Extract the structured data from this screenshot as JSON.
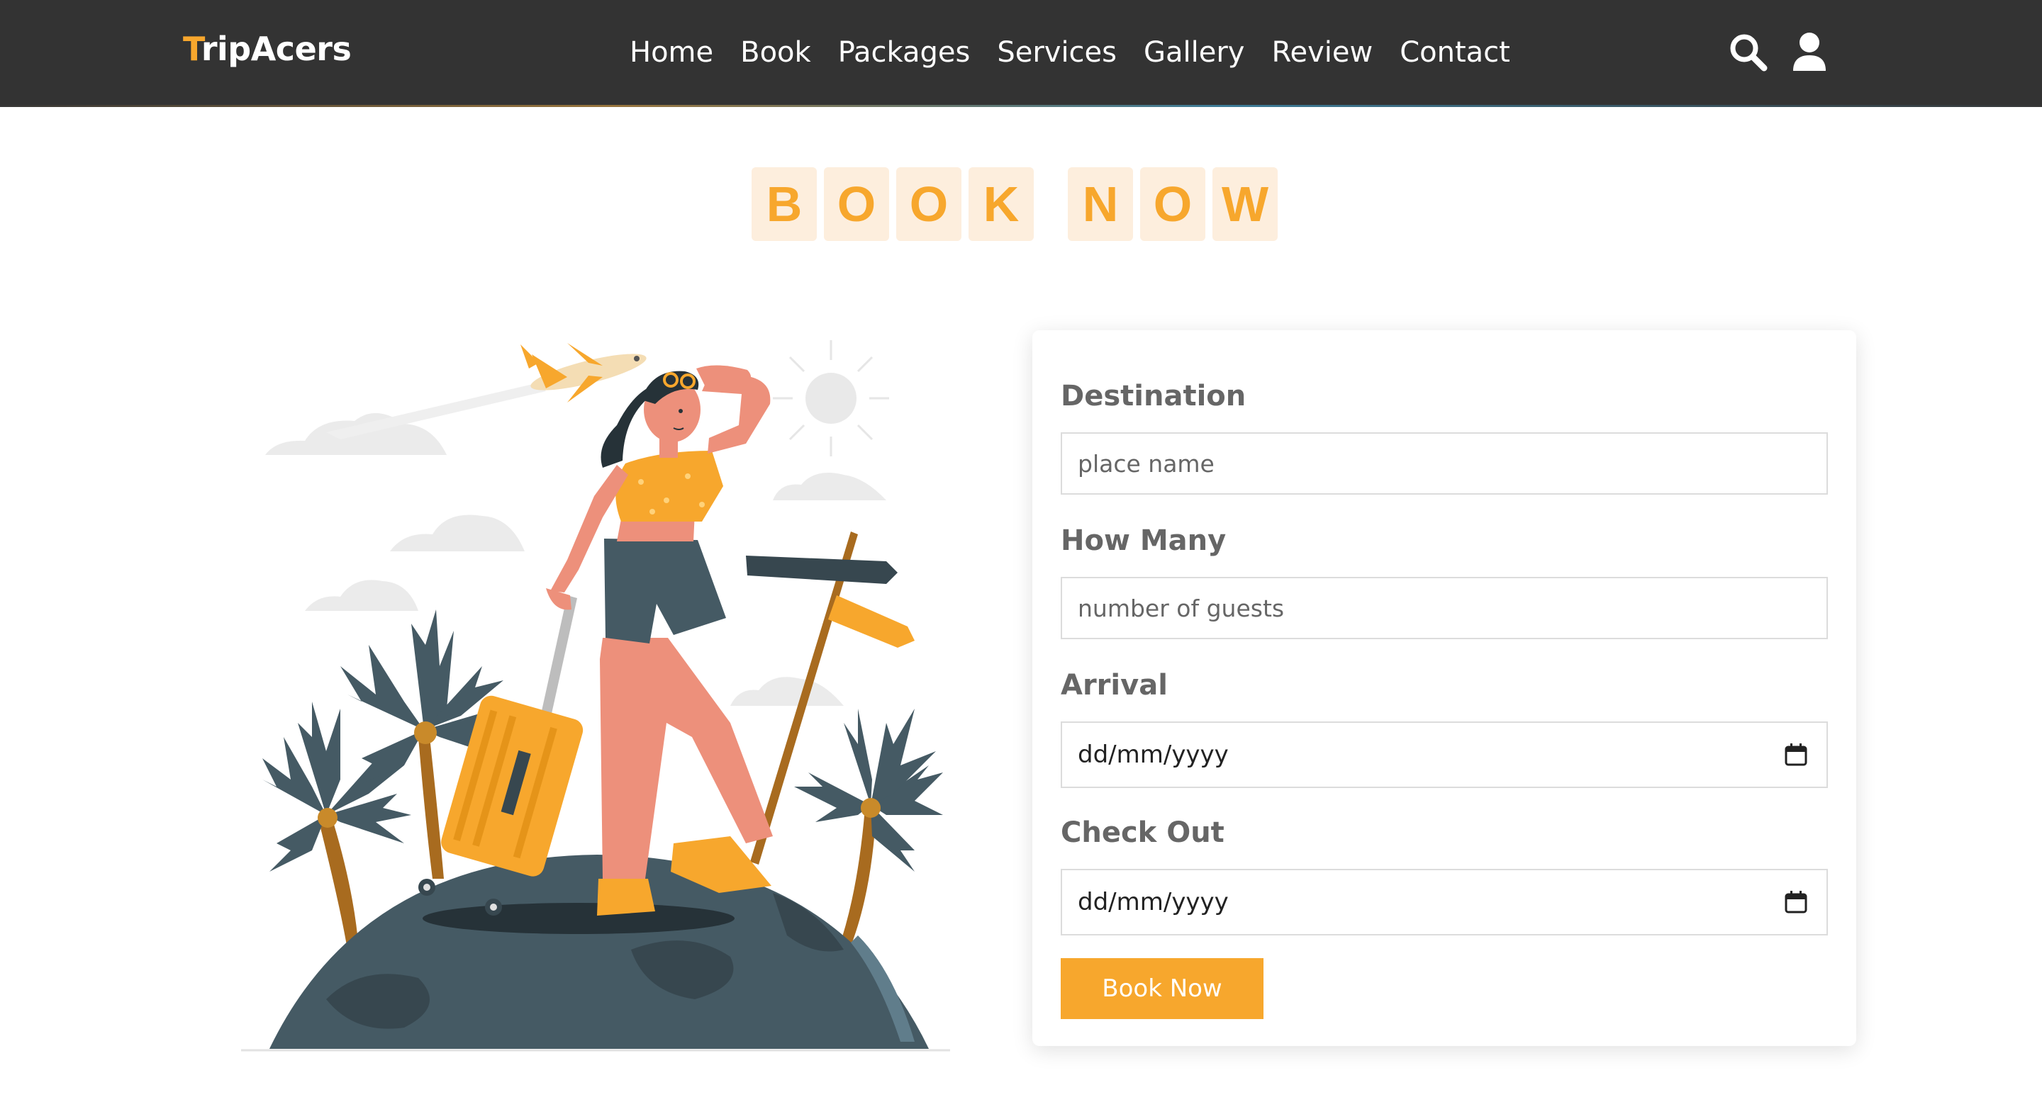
{
  "brand": {
    "first_letter": "T",
    "rest": "ripAcers"
  },
  "nav": {
    "items": [
      "Home",
      "Book",
      "Packages",
      "Services",
      "Gallery",
      "Review",
      "Contact"
    ]
  },
  "heading": {
    "word1": [
      "B",
      "O",
      "O",
      "K"
    ],
    "word2": [
      "N",
      "O",
      "W"
    ]
  },
  "form": {
    "destination": {
      "label": "Destination",
      "placeholder": "place name"
    },
    "guests": {
      "label": "How Many",
      "placeholder": "number of guests"
    },
    "arrival": {
      "label": "Arrival",
      "value": "dd/mm/yyyy"
    },
    "checkout": {
      "label": "Check Out",
      "value": "dd/mm/yyyy"
    },
    "submit": "Book Now"
  },
  "icons": {
    "search": "search-icon",
    "user": "user-icon",
    "calendar": "calendar-icon"
  },
  "colors": {
    "accent": "#f7a72d",
    "header_bg": "#333333",
    "tile_bg": "#fdeedd",
    "label": "#666666"
  }
}
